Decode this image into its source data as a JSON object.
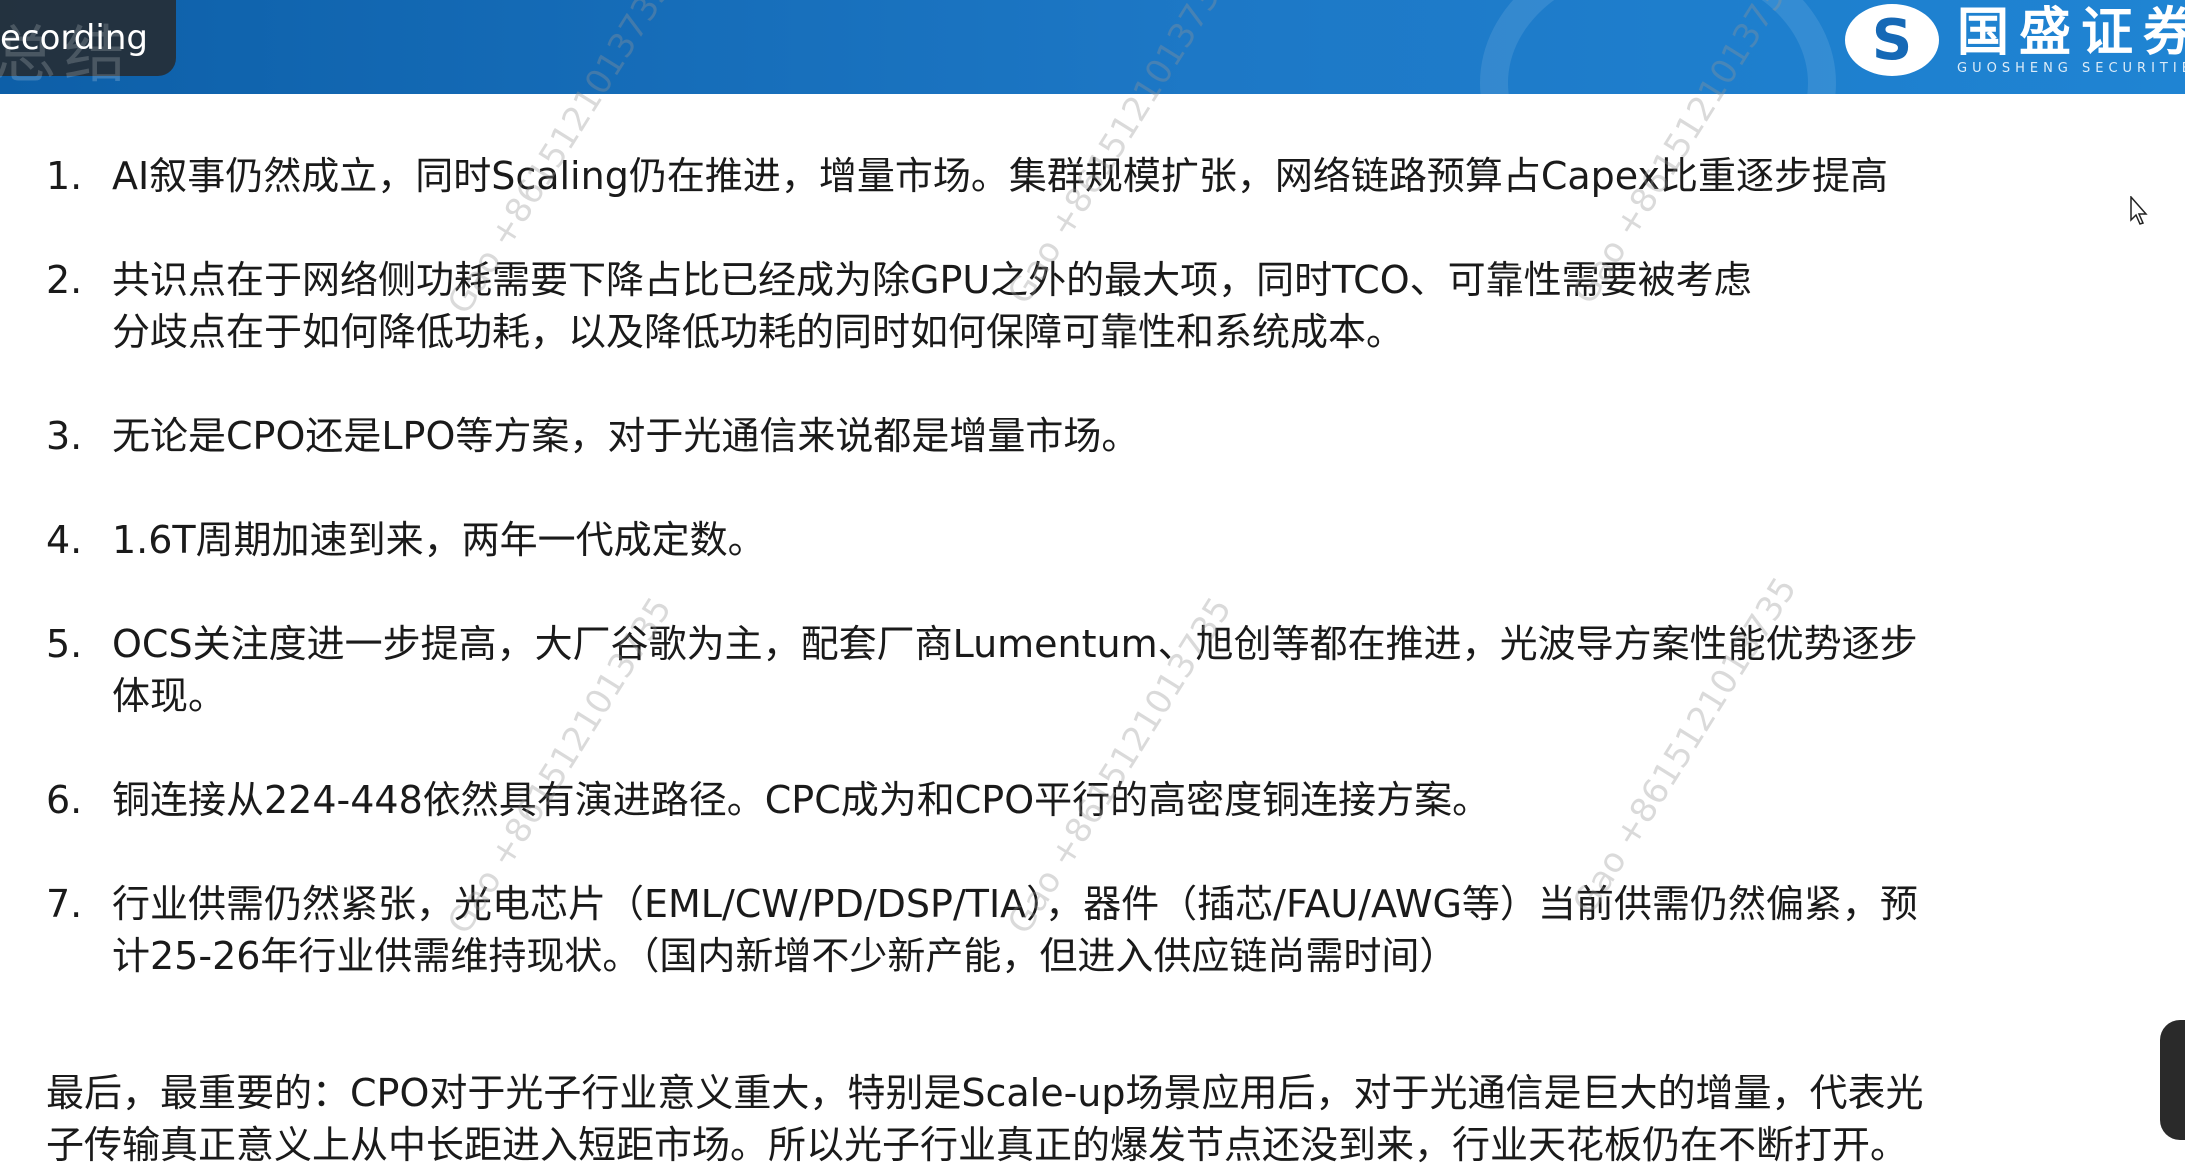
{
  "recording": {
    "label": "ecording",
    "ghost_text": "总结"
  },
  "brand": {
    "name_cn": "国盛证券",
    "name_en": "GUOSHENG SECURITIES",
    "accent": "#1669b6"
  },
  "watermark": {
    "text": "Gao +8615121013735"
  },
  "items": [
    {
      "num": "1.",
      "lines": [
        "AI叙事仍然成立，同时Scaling仍在推进，增量市场。集群规模扩张，网络链路预算占Capex比重逐步提高"
      ]
    },
    {
      "num": "2.",
      "lines": [
        "共识点在于网络侧功耗需要下降占比已经成为除GPU之外的最大项，同时TCO、可靠性需要被考虑",
        "分歧点在于如何降低功耗，以及降低功耗的同时如何保障可靠性和系统成本。"
      ]
    },
    {
      "num": "3.",
      "lines": [
        "无论是CPO还是LPO等方案，对于光通信来说都是增量市场。"
      ]
    },
    {
      "num": "4.",
      "lines": [
        "1.6T周期加速到来，两年一代成定数。"
      ]
    },
    {
      "num": "5.",
      "lines": [
        "OCS关注度进一步提高，大厂谷歌为主，配套厂商Lumentum、旭创等都在推进，光波导方案性能优势逐步",
        "体现。"
      ]
    },
    {
      "num": "6.",
      "lines": [
        "铜连接从224-448依然具有演进路径。CPC成为和CPO平行的高密度铜连接方案。"
      ]
    },
    {
      "num": "7.",
      "lines": [
        "行业供需仍然紧张，光电芯片（EML/CW/PD/DSP/TIA），器件（插芯/FAU/AWG等）当前供需仍然偏紧，预",
        "计25-26年行业供需维持现状。（国内新增不少新产能，但进入供应链尚需时间）"
      ]
    }
  ],
  "final": {
    "lines": [
      "最后，最重要的：CPO对于光子行业意义重大，特别是Scale-up场景应用后，对于光通信是巨大的增量，代表光",
      "子传输真正意义上从中长距进入短距市场。所以光子行业真正的爆发节点还没到来，行业天花板仍在不断打开。"
    ]
  }
}
